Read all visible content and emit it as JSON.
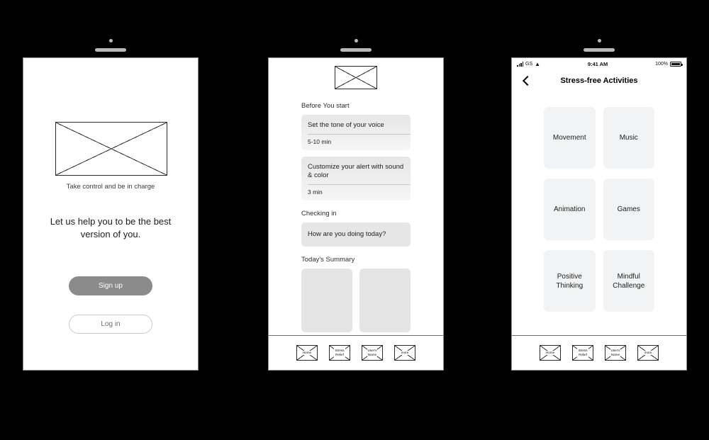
{
  "screens": [
    {
      "name": "welcome",
      "hero_placeholder": "image-placeholder",
      "caption": "Take control and be in charge",
      "headline": "Let us help you to be the best version of you.",
      "primary_button": "Sign up",
      "secondary_button": "Log in"
    },
    {
      "name": "home",
      "logo_placeholder": "image-placeholder",
      "sections": [
        {
          "title": "Before You start",
          "cards": [
            {
              "title": "Set the tone of your voice",
              "meta": "5-10 min"
            },
            {
              "title": "Customize your alert with sound & color",
              "meta": "3 min"
            }
          ]
        },
        {
          "title": "Checking in",
          "cards": [
            {
              "title": "How are you doing today?",
              "meta": ""
            }
          ]
        },
        {
          "title": "Today's Summary",
          "cards": []
        }
      ]
    },
    {
      "name": "stress-free-activities",
      "statusbar": {
        "carrier": "GS",
        "time": "9:41 AM",
        "battery_percent": "100%"
      },
      "navbar": {
        "back": "chevron-left-icon",
        "title": "Stress-free Activities"
      },
      "activities": [
        "Movement",
        "Music",
        "Animation",
        "Games",
        "Positive\nThinking",
        "Mindful\nChallenge"
      ]
    }
  ],
  "tabbar": {
    "items": [
      {
        "label": "Home"
      },
      {
        "label": "Stress\nRelief"
      },
      {
        "label": "User's\nName"
      },
      {
        "label": "more"
      }
    ]
  },
  "colors": {
    "background": "#000000",
    "screen": "#ffffff",
    "primary_button": "#8b8b8b",
    "card": "#e6e6e6",
    "grid_card": "#f2f3f4"
  }
}
